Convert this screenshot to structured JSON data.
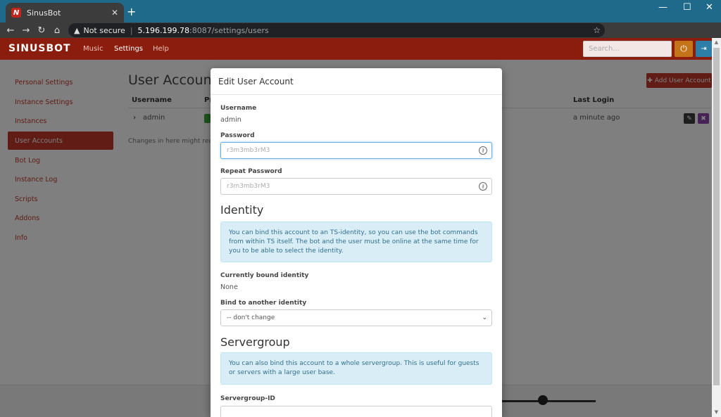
{
  "browser": {
    "tab_title": "SinusBot",
    "tab_favicon_letter": "N",
    "tab_close": "✕",
    "new_tab": "+",
    "security_label": "Not secure",
    "url_host": "5.196.199.78",
    "url_path": ":8087/settings/users"
  },
  "app": {
    "logo": "SINUSBOT",
    "nav": [
      "Music",
      "Settings",
      "Help"
    ],
    "search_placeholder": "Search..."
  },
  "sidebar": {
    "items": [
      {
        "label": "Personal Settings"
      },
      {
        "label": "Instance Settings"
      },
      {
        "label": "Instances"
      },
      {
        "label": "User Accounts"
      },
      {
        "label": "Bot Log"
      },
      {
        "label": "Instance Log"
      },
      {
        "label": "Scripts"
      },
      {
        "label": "Addons"
      },
      {
        "label": "Info"
      }
    ]
  },
  "page": {
    "title": "User Accounts",
    "add_button": "Add User Account",
    "columns": {
      "username": "Username",
      "privileges": "Pr",
      "last_login": "Last Login"
    },
    "row": {
      "username": "admin",
      "last_login": "a minute ago"
    },
    "help_text": "Changes in here might require"
  },
  "modal": {
    "title": "Edit User Account",
    "username_label": "Username",
    "username_value": "admin",
    "password_label": "Password",
    "password_placeholder": "r3m3mb3rM3",
    "repeat_label": "Repeat Password",
    "repeat_placeholder": "r3m3mb3rM3",
    "identity_heading": "Identity",
    "identity_info": "You can bind this account to an TS-identity, so you can use the bot commands from within TS itself. The bot and the user must be online at the same time for you to be able to select the identity.",
    "bound_label": "Currently bound identity",
    "bound_value": "None",
    "bind_label": "Bind to another identity",
    "bind_value": "-- don't change",
    "servergroup_heading": "Servergroup",
    "servergroup_info": "You can also bind this account to a whole servergroup. This is useful for guests or servers with a large user base.",
    "servergroup_id_label": "Servergroup-ID"
  },
  "colors": {
    "brand": "#8b1d0e",
    "accent": "#c0392b",
    "info_bg": "#d9edf7"
  }
}
